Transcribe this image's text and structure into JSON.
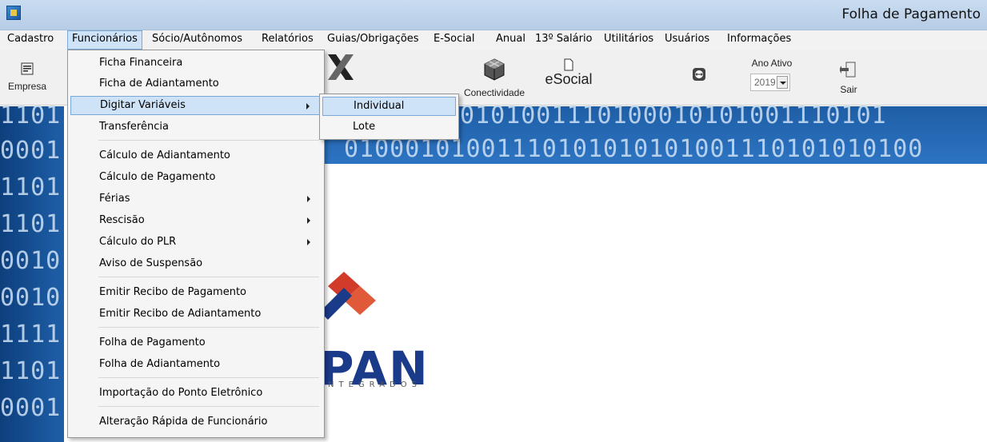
{
  "window": {
    "title": "Folha de Pagamento"
  },
  "menubar": {
    "items": [
      "Cadastro",
      "Funcionários",
      "Sócio/Autônomos",
      "Relatórios",
      "Guias/Obrigações",
      "E-Social",
      "Anual",
      "13º Salário",
      "Utilitários",
      "Usuários",
      "Informações"
    ],
    "open_index": 1
  },
  "toolbar": {
    "empresa_label": "Empresa",
    "conectividade_label": "Conectividade",
    "esocial_label": "eSocial",
    "ano_ativo_label": "Ano Ativo",
    "ano_ativo_value": "2019",
    "sair_label": "Sair"
  },
  "funcionarios_menu": {
    "items": [
      {
        "label": "Ficha Financeira"
      },
      {
        "label": "Ficha de Adiantamento"
      },
      {
        "label": "Digitar Variáveis",
        "submenu": true,
        "highlighted": true
      },
      {
        "label": "Transferência"
      },
      {
        "label": "Cálculo de Adiantamento"
      },
      {
        "label": "Cálculo de Pagamento"
      },
      {
        "label": "Férias",
        "submenu": true
      },
      {
        "label": "Rescisão",
        "submenu": true
      },
      {
        "label": "Cálculo do PLR",
        "submenu": true
      },
      {
        "label": "Aviso de Suspensão"
      },
      {
        "label": "Emitir Recibo de Pagamento"
      },
      {
        "label": "Emitir Recibo de Adiantamento"
      },
      {
        "label": "Folha de Pagamento"
      },
      {
        "label": "Folha de Adiantamento"
      },
      {
        "label": "Importação do Ponto Eletrônico"
      },
      {
        "label": "Alteração Rápida de Funcionário"
      }
    ]
  },
  "digitar_variaveis_submenu": {
    "items": [
      {
        "label": "Individual",
        "highlighted": true
      },
      {
        "label": "Lote"
      }
    ]
  },
  "background": {
    "binary_rows": [
      "1101",
      "0001",
      "1101",
      "1101",
      "0010",
      "0010",
      "1111",
      "1101",
      "0001"
    ],
    "binary_top_row1": "0101001110100010101001110101",
    "binary_top_row2": "01000101001110101010101001110101010100"
  },
  "logo": {
    "text": "PAN",
    "subtext": "NTEGRADOS"
  },
  "colors": {
    "highlight": "#cfe3f8",
    "highlight_border": "#7aa8d8",
    "brand_blue": "#1a3a8a",
    "brand_red": "#d23a2a"
  }
}
